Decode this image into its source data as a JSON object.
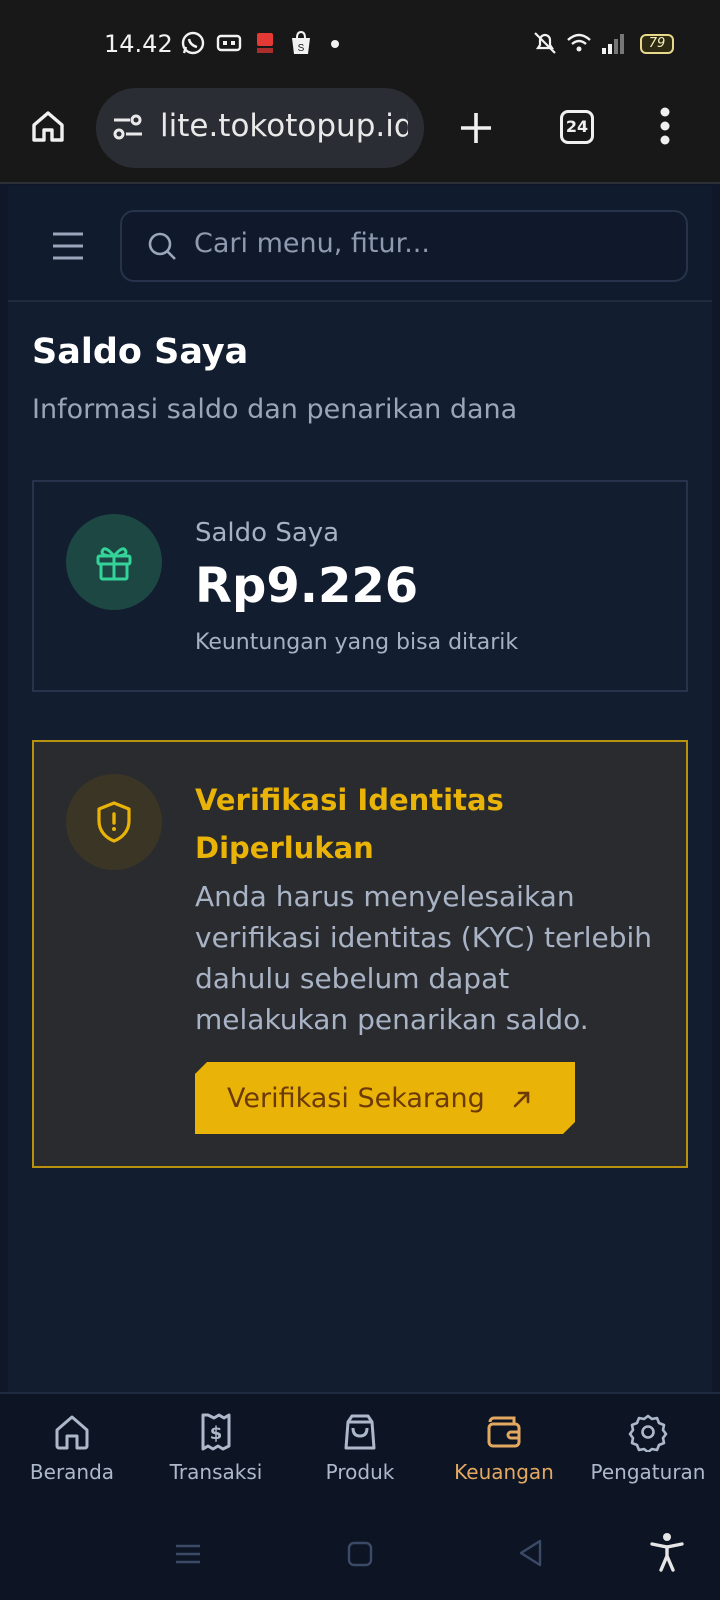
{
  "status_bar": {
    "time": "14.42",
    "battery": "79",
    "icons": [
      "whatsapp-icon",
      "game-icon",
      "shopee-pay-icon",
      "shopee-icon",
      "dot-icon",
      "mute-bell-icon",
      "wifi-icon",
      "signal-icon",
      "battery-icon"
    ]
  },
  "browser": {
    "url": "lite.tokotopup.id/l",
    "tab_count": "24",
    "icons": [
      "home-icon",
      "site-settings-icon",
      "new-tab-icon",
      "tabs-icon",
      "more-icon"
    ]
  },
  "header": {
    "search_placeholder": "Cari menu, fitur..."
  },
  "page": {
    "title": "Saldo Saya",
    "subtitle": "Informasi saldo dan penarikan dana"
  },
  "balance_card": {
    "label": "Saldo Saya",
    "amount": "Rp9.226",
    "note": "Keuntungan yang bisa ditarik",
    "accent": "#34d399"
  },
  "kyc_card": {
    "title": "Verifikasi Identitas Diperlukan",
    "body": "Anda harus menyelesaikan verifikasi identitas (KYC) terlebih dahulu sebelum dapat melakukan penarikan saldo.",
    "button_label": "Verifikasi Sekarang",
    "accent": "#eab308"
  },
  "bottom_nav": {
    "items": [
      {
        "label": "Beranda",
        "icon": "home-icon"
      },
      {
        "label": "Transaksi",
        "icon": "receipt-icon"
      },
      {
        "label": "Produk",
        "icon": "shopping-bag-icon"
      },
      {
        "label": "Keuangan",
        "icon": "wallet-icon"
      },
      {
        "label": "Pengaturan",
        "icon": "gear-icon"
      }
    ],
    "active": "Keuangan",
    "active_color": "#e3a860"
  }
}
